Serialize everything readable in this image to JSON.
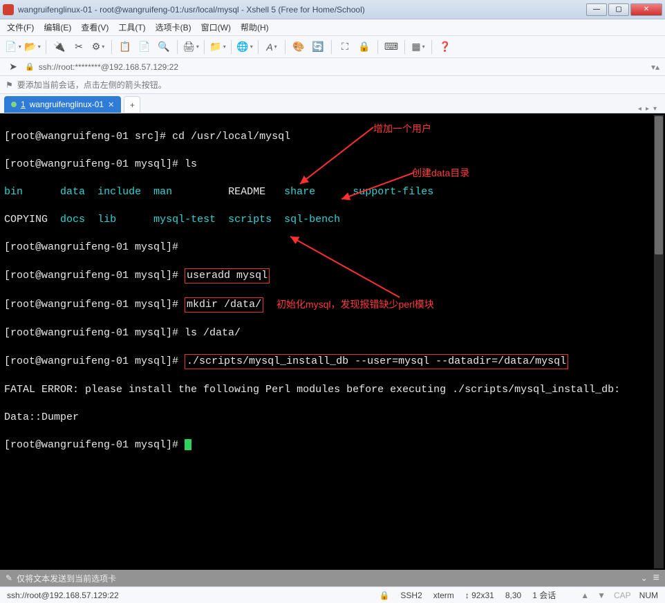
{
  "window": {
    "title": "wangruifenglinux-01 - root@wangruifeng-01:/usr/local/mysql - Xshell 5 (Free for Home/School)"
  },
  "menus": {
    "file": "文件(F)",
    "edit": "编辑(E)",
    "view": "查看(V)",
    "tools": "工具(T)",
    "tabs": "选项卡(B)",
    "window": "窗口(W)",
    "help": "帮助(H)"
  },
  "address": {
    "text": "ssh://root:********@192.168.57.129:22"
  },
  "hint": {
    "text": "要添加当前会话，点击左侧的箭头按钮。"
  },
  "tab": {
    "index": "1",
    "name": "wangruifenglinux-01",
    "add": "+"
  },
  "term": {
    "p_src": "[root@wangruifeng-01 src]# ",
    "p_mysql": "[root@wangruifeng-01 mysql]# ",
    "cmd_cd": "cd /usr/local/mysql",
    "cmd_ls": "ls",
    "ls_row1_bin": "bin",
    "ls_row1_data": "data",
    "ls_row1_include": "include",
    "ls_row1_man": "man",
    "ls_row1_readme": "README",
    "ls_row1_share": "share",
    "ls_row1_support": "support-files",
    "ls_row2_copying": "COPYING",
    "ls_row2_docs": "docs",
    "ls_row2_lib": "lib",
    "ls_row2_mysqltest": "mysql-test",
    "ls_row2_scripts": "scripts",
    "ls_row2_sqlbench": "sql-bench",
    "cmd_useradd": "useradd mysql",
    "cmd_mkdir": "mkdir /data/",
    "cmd_lsdata": "ls /data/",
    "cmd_install": "./scripts/mysql_install_db --user=mysql --datadir=/data/mysql",
    "err_line": "FATAL ERROR: please install the following Perl modules before executing ./scripts/mysql_install_db:",
    "err_mod": "Data::Dumper"
  },
  "annot": {
    "add_user": "增加一个用户",
    "mkdir": "创建data目录",
    "init": "初始化mysql，发现报错缺少perl模块"
  },
  "sendbar": {
    "text": "仅将文本发送到当前选项卡"
  },
  "status": {
    "conn": "ssh://root@192.168.57.129:22",
    "proto": "SSH2",
    "term": "xterm",
    "size": "92x31",
    "cursor": "8,30",
    "sessions": "1 会话",
    "cap": "CAP",
    "num": "NUM"
  },
  "icons": {
    "lock": "🔒",
    "flag": "⚑",
    "pencil": "✎",
    "hamburger": "≡",
    "down": "⌄",
    "bolt": "⚡",
    "updown": "↕"
  }
}
